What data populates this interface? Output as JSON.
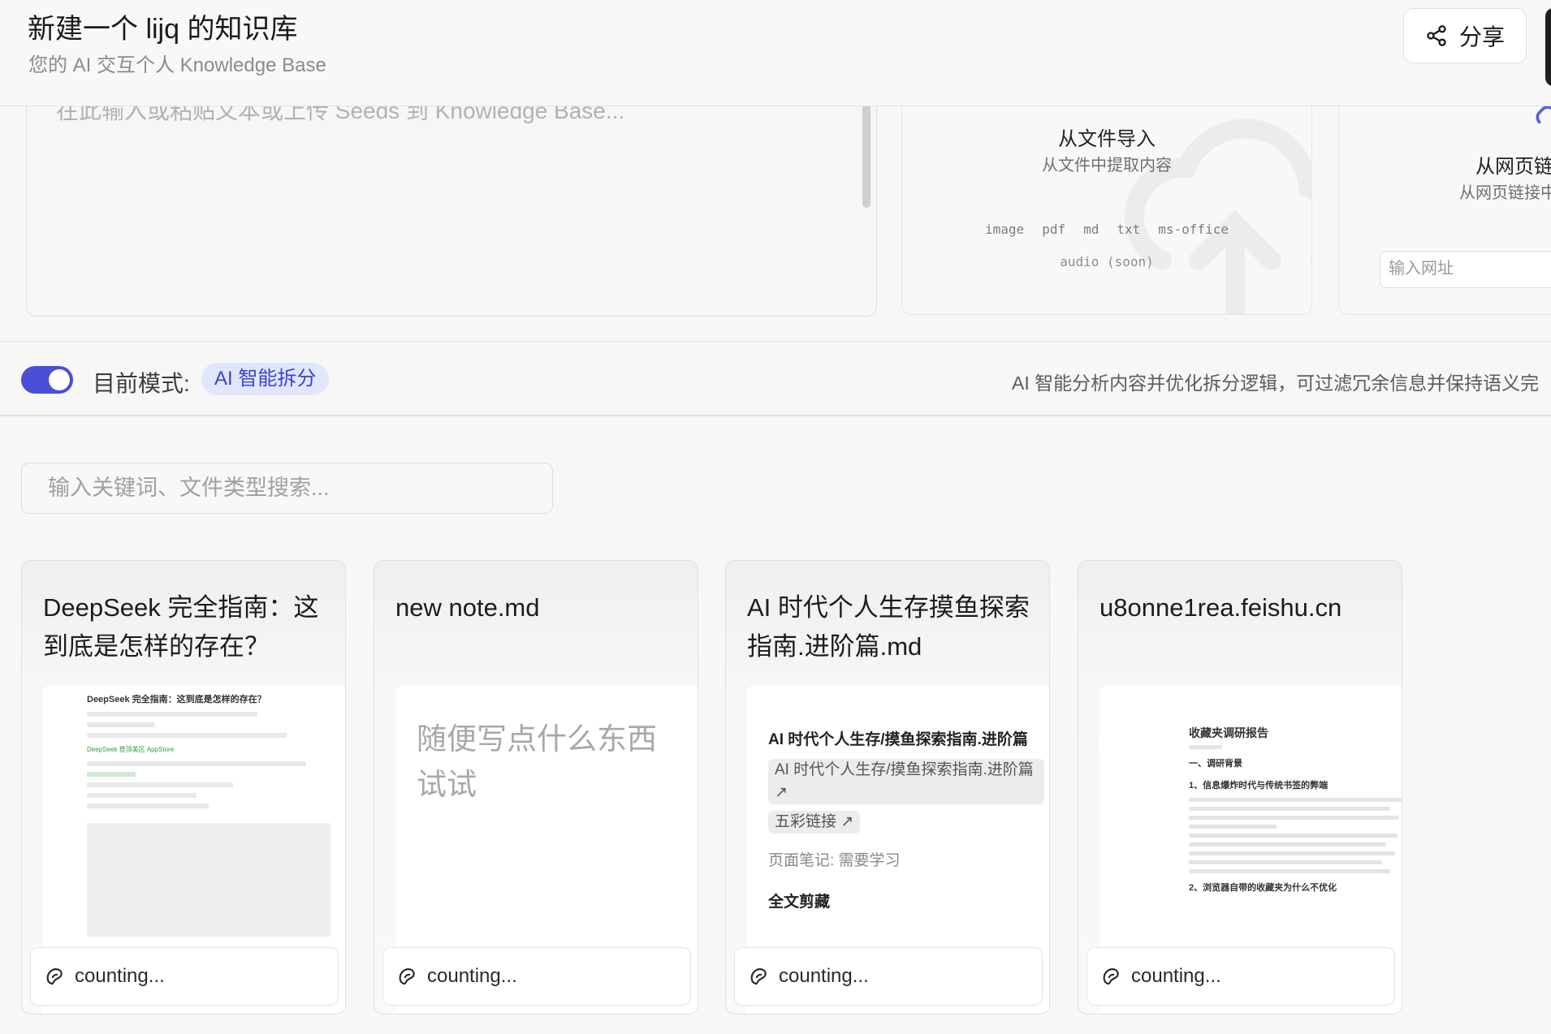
{
  "header": {
    "title": "新建一个 lijq 的知识库",
    "subtitle": "您的 AI 交互个人 Knowledge Base",
    "share_label": "分享"
  },
  "importers": {
    "text_placeholder": "在此输入或粘贴文本或上传 Seeds 到 Knowledge Base...",
    "file": {
      "title": "从文件导入",
      "subtitle": "从文件中提取内容",
      "types": [
        "image",
        "pdf",
        "md",
        "txt",
        "ms-office"
      ],
      "soon": "audio (soon)"
    },
    "web": {
      "title": "从网页链",
      "subtitle": "从网页链接中",
      "url_placeholder": "输入网址"
    }
  },
  "mode": {
    "label": "目前模式:",
    "badge": "AI 智能拆分",
    "description": "AI 智能分析内容并优化拆分逻辑，可过滤冗余信息并保持语义完"
  },
  "search": {
    "placeholder": "输入关键词、文件类型搜索..."
  },
  "cards": [
    {
      "title": "DeepSeek 完全指南：这到底是怎样的存在？",
      "footer": "counting...",
      "preview": {
        "doc_title": "DeepSeek 完全指南：这到底是怎样的存在？",
        "green_text": "DeepSeek 登顶美区 AppStore"
      }
    },
    {
      "title": "new note.md",
      "footer": "counting...",
      "preview": {
        "text": "随便写点什么东西试试"
      }
    },
    {
      "title": "AI 时代个人生存摸鱼探索指南.进阶篇.md",
      "footer": "counting...",
      "preview": {
        "heading": "AI 时代个人生存/摸鱼探索指南.进阶篇",
        "chip1": "AI 时代个人生存/摸鱼探索指南.进阶篇",
        "chip2": "五彩链接",
        "note": "页面笔记: 需要学习",
        "section": "全文剪藏"
      }
    },
    {
      "title": "u8onne1rea.feishu.cn",
      "footer": "counting...",
      "preview": {
        "doc_title": "收藏夹调研报告",
        "sec1": "一、调研背景",
        "sec2": "1、信息爆炸时代与传统书签的弊端",
        "sec3": "2、浏览器自带的收藏夹为什么不优化"
      }
    }
  ],
  "colors": {
    "accent": "#4a4fd8",
    "badge_bg": "#e2e6fb",
    "badge_text": "#3a45c8"
  }
}
